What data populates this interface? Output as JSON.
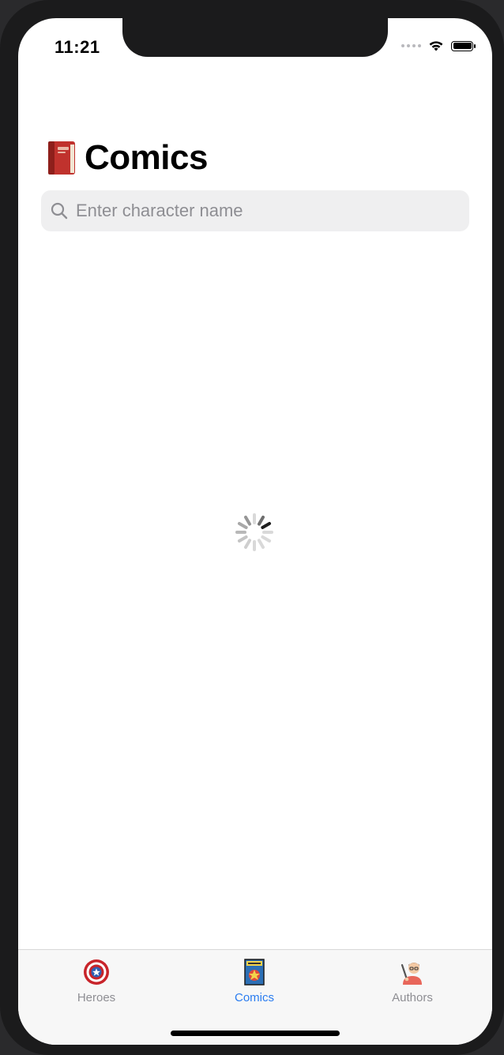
{
  "status_bar": {
    "time": "11:21"
  },
  "header": {
    "title": "Comics",
    "icon": "closed-book-icon"
  },
  "search": {
    "placeholder": "Enter character name",
    "value": "",
    "icon": "search-icon"
  },
  "loading": {
    "icon": "activity-spinner-icon"
  },
  "tab_bar": {
    "items": [
      {
        "label": "Heroes",
        "icon": "shield-icon",
        "selected": false
      },
      {
        "label": "Comics",
        "icon": "comic-book-icon",
        "selected": true
      },
      {
        "label": "Authors",
        "icon": "author-icon",
        "selected": false
      }
    ]
  },
  "colors": {
    "accent": "#2a7cf0",
    "background": "#ffffff",
    "tab_inactive": "#8e8e93"
  }
}
